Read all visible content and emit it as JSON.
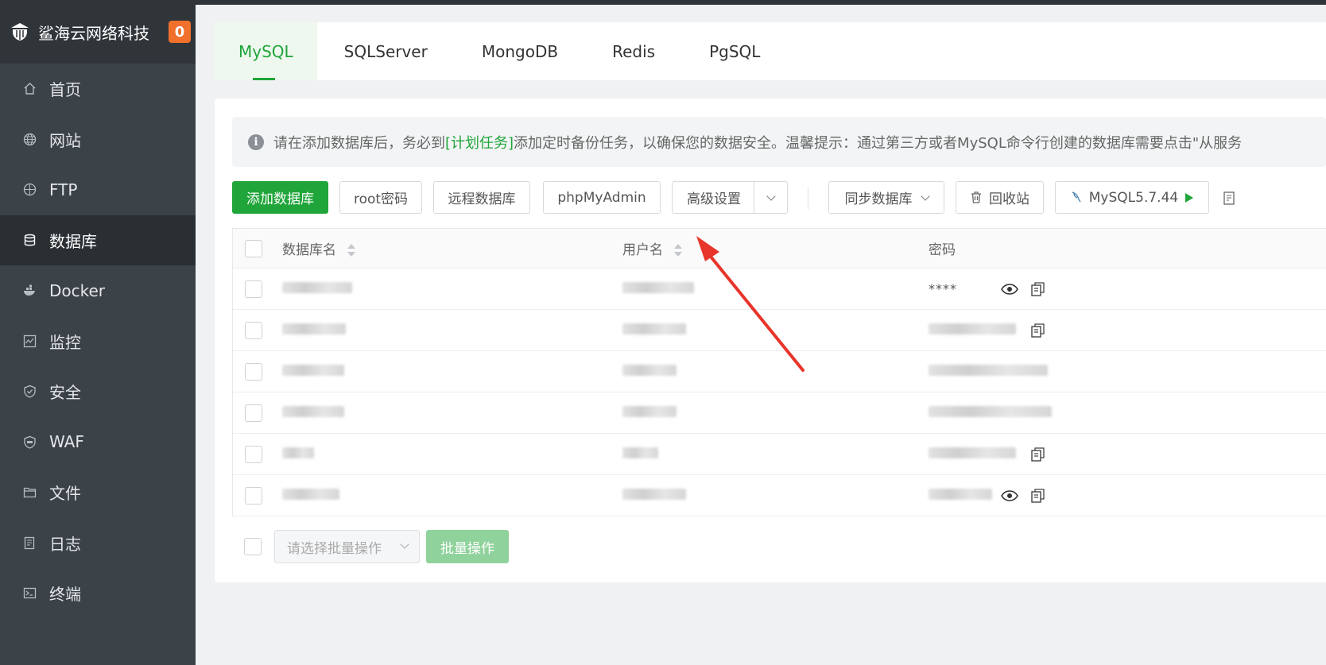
{
  "sidebar": {
    "brand_name": "鲨海云网络科技",
    "badge_count": "0",
    "items": [
      {
        "label": "首页",
        "icon": "home-icon"
      },
      {
        "label": "网站",
        "icon": "globe-icon"
      },
      {
        "label": "FTP",
        "icon": "ftp-globe-icon"
      },
      {
        "label": "数据库",
        "icon": "database-icon",
        "active": true
      },
      {
        "label": "Docker",
        "icon": "docker-icon"
      },
      {
        "label": "监控",
        "icon": "monitor-icon"
      },
      {
        "label": "安全",
        "icon": "shield-icon"
      },
      {
        "label": "WAF",
        "icon": "waf-shield-icon"
      },
      {
        "label": "文件",
        "icon": "folder-icon"
      },
      {
        "label": "日志",
        "icon": "log-icon"
      },
      {
        "label": "终端",
        "icon": "terminal-icon"
      }
    ]
  },
  "tabs": [
    "MySQL",
    "SQLServer",
    "MongoDB",
    "Redis",
    "PgSQL"
  ],
  "notice": {
    "before": "请在添加数据库后，务必到",
    "link": "[计划任务]",
    "after": "添加定时备份任务，以确保您的数据安全。温馨提示：通过第三方或者MySQL命令行创建的数据库需要点击\"从服务"
  },
  "toolbar": {
    "add_db": "添加数据库",
    "root_pw": "root密码",
    "remote_db": "远程数据库",
    "phpmyadmin": "phpMyAdmin",
    "advanced": "高级设置",
    "sync_db": "同步数据库",
    "recycle": "回收站",
    "mysql_version": "MySQL5.7.44"
  },
  "table": {
    "headers": {
      "name": "数据库名",
      "user": "用户名",
      "password": "密码"
    },
    "first_row_password": "****"
  },
  "batch": {
    "select_placeholder": "请选择批量操作",
    "button": "批量操作"
  },
  "colors": {
    "accent": "#20a53a",
    "badge": "#f0702c",
    "sidebar": "#3b4248",
    "arrow": "#e8352b"
  }
}
